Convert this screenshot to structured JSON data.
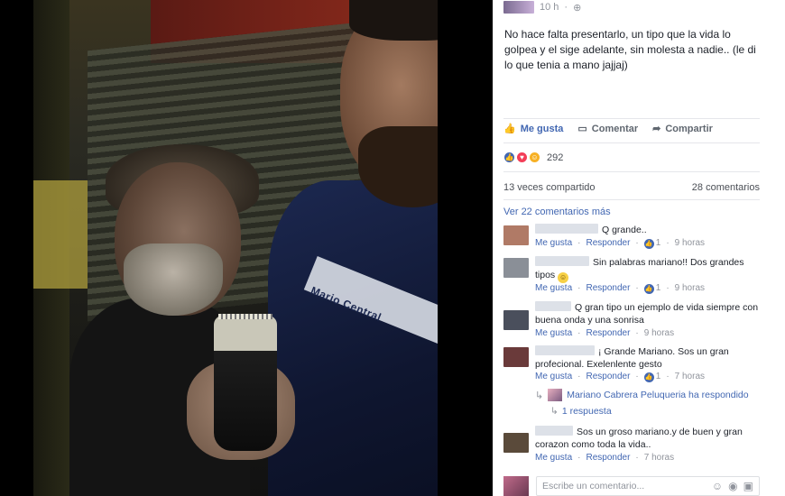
{
  "post": {
    "time": "10 h",
    "privacy_icon": "globe-icon",
    "text": "No hace falta presentarlo, un tipo que la vida lo golpea y el sige adelante, sin molesta a nadie.. (le di lo que tenia a mano jajjaj)",
    "jersey_text": "Mario Central"
  },
  "actions": {
    "like": "Me gusta",
    "comment": "Comentar",
    "share": "Compartir"
  },
  "reactions": {
    "count": "292",
    "icons": [
      "like-icon",
      "love-icon",
      "haha-icon"
    ]
  },
  "stats": {
    "shares": "13 veces compartido",
    "comments": "28 comentarios"
  },
  "more_comments": "Ver 22 comentarios más",
  "comments": [
    {
      "text": "Q grande..",
      "like": "Me gusta",
      "reply": "Responder",
      "likes": "1",
      "time": "9 horas",
      "avatar_color": "#b07a66"
    },
    {
      "text": "Sin palabras mariano!! Dos grandes tipos",
      "like": "Me gusta",
      "reply": "Responder",
      "likes": "1",
      "time": "9 horas",
      "avatar_color": "#8a8f97"
    },
    {
      "text": "Q gran tipo un ejemplo de vida siempre con buena onda y una sonrisa",
      "like": "Me gusta",
      "reply": "Responder",
      "likes": "",
      "time": "9 horas",
      "avatar_color": "#4a4f5c"
    },
    {
      "text": "¡ Grande Mariano. Sos un gran profecional. Exelenlente gesto",
      "like": "Me gusta",
      "reply": "Responder",
      "likes": "1",
      "time": "7 horas",
      "avatar_color": "#6a3a3a"
    },
    {
      "text": "Sos un groso mariano.y de buen y gran corazon como toda la vida..",
      "like": "Me gusta",
      "reply": "Responder",
      "likes": "",
      "time": "7 horas",
      "avatar_color": "#5a4a3a"
    }
  ],
  "reply": {
    "text": "Mariano Cabrera Peluqueria ha respondido",
    "count": "1 respuesta"
  },
  "write": {
    "placeholder": "Escribe un comentario...",
    "icons": [
      "emoji-icon",
      "camera-icon",
      "gif-icon"
    ]
  },
  "colors": {
    "link": "#4267b2",
    "text": "#1d2129",
    "meta": "#90949c"
  }
}
